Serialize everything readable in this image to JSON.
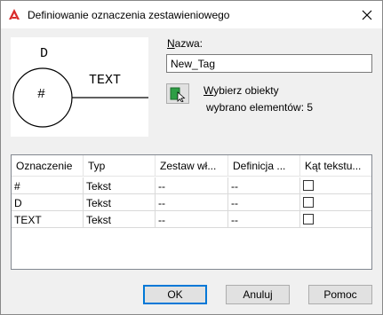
{
  "window": {
    "title": "Definiowanie oznaczenia zestawieniowego"
  },
  "preview": {
    "top_letter": "D",
    "center_symbol": "#",
    "right_text": "TEXT"
  },
  "name_field": {
    "label_prefix": "",
    "label_underlined": "N",
    "label_rest": "azwa:",
    "value": "New_Tag"
  },
  "select_objects": {
    "label_underlined": "W",
    "label_rest": "ybierz obiekty",
    "count_text": "wybrano elementów: 5"
  },
  "grid": {
    "columns": [
      "Oznaczenie",
      "Typ",
      "Zestaw wł...",
      "Definicja ...",
      "Kąt tekstu..."
    ],
    "rows": [
      {
        "oznaczenie": "#",
        "typ": "Tekst",
        "zestaw": "--",
        "definicja": "--",
        "kat_checked": false
      },
      {
        "oznaczenie": "D",
        "typ": "Tekst",
        "zestaw": "--",
        "definicja": "--",
        "kat_checked": false
      },
      {
        "oznaczenie": "TEXT",
        "typ": "Tekst",
        "zestaw": "--",
        "definicja": "--",
        "kat_checked": false
      }
    ]
  },
  "buttons": {
    "ok": "OK",
    "cancel": "Anuluj",
    "help": "Pomoc"
  },
  "colors": {
    "accent": "#0078d7",
    "app_icon_red": "#d92b2b",
    "select_icon_green": "#2e9e45"
  }
}
